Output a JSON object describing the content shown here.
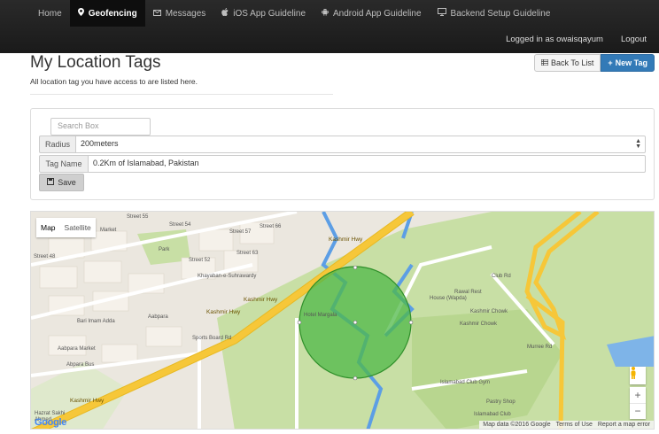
{
  "nav": {
    "items": [
      {
        "label": "Home",
        "icon": "",
        "active": false
      },
      {
        "label": "Geofencing",
        "icon": "map-marker-icon",
        "active": true
      },
      {
        "label": "Messages",
        "icon": "envelope-icon",
        "active": false
      },
      {
        "label": "iOS App Guideline",
        "icon": "apple-icon",
        "active": false
      },
      {
        "label": "Android App Guideline",
        "icon": "android-icon",
        "active": false
      },
      {
        "label": "Backend Setup Guideline",
        "icon": "monitor-icon",
        "active": false
      }
    ],
    "logged_in": "Logged in as owaisqayum",
    "logout": "Logout"
  },
  "page": {
    "title": "My Location Tags",
    "subtitle": "All location tag you have access to are listed here."
  },
  "actions": {
    "back_label": "Back To List",
    "new_label": "New Tag"
  },
  "form": {
    "search_placeholder": "Search Box",
    "radius_label": "Radius",
    "radius_value": "200meters",
    "tagname_label": "Tag Name",
    "tagname_value": "0.2Km of Islamabad, Pakistan",
    "save_label": "Save"
  },
  "map": {
    "type_map": "Map",
    "type_satellite": "Satellite",
    "google": "Google",
    "attrib_data": "Map data ©2016 Google",
    "attrib_terms": "Terms of Use",
    "attrib_report": "Report a map error",
    "zoom_in": "+",
    "zoom_out": "−",
    "labels": {
      "street55": "Street 55",
      "street54": "Street 54",
      "street57": "Street 57",
      "street66": "Street 66",
      "street48": "Street 48",
      "street52": "Street 52",
      "street63": "Street 63",
      "market": "Market",
      "park": "Park",
      "khayaban": "Khayaban-e-Suhrawardy",
      "kashmir1": "Kashmir Hwy",
      "kashmir2": "Kashmir Hwy",
      "kashmir3": "Kashmir Hwy",
      "kashmir4": "Kashmir Hwy",
      "bari": "Bari Imam Adda",
      "aabpara": "Aabpara",
      "aabpara_market": "Aabpara Market",
      "abpara_bus": "Abpara Bus",
      "sports": "Sports Board Rd",
      "hotel": "Hotel Margala",
      "rawal": "Rawal Rest",
      "house": "House (Wapda)",
      "chowk1": "Kashmir Chowk",
      "chowk2": "Kashmir Chowk",
      "club_rd": "Club Rd",
      "murree": "Murree Rd",
      "club_gym": "Islamabad Club Gym",
      "pastry": "Pastry Shop",
      "islamabad_club": "Islamabad Club",
      "hazrat": "Hazrat Sakhi",
      "ahmed": "Ahmed"
    }
  },
  "colors": {
    "primary": "#337ab7",
    "circle_fill": "#4fb848",
    "park_green": "#c8dfa5",
    "highway": "#f6c739",
    "water": "#5c9ee5"
  }
}
